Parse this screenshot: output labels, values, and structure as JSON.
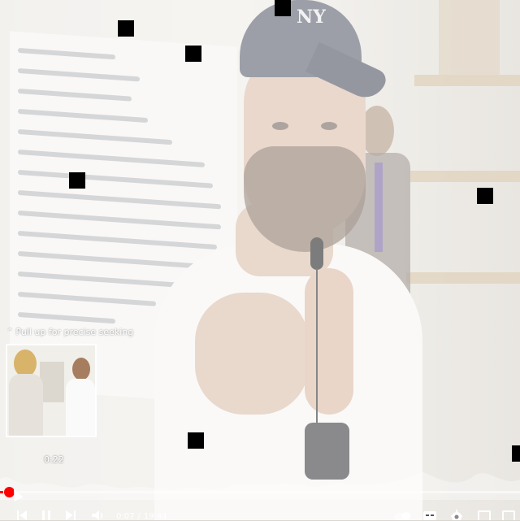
{
  "player": {
    "seek_hint": "Pull up for precise seeking",
    "preview_time": "0:22",
    "current_time": "0:07",
    "time_separator": "/",
    "duration": "19:44",
    "progress": 0.006
  },
  "video": {
    "cap_logo": "NY"
  },
  "colors": {
    "progress": "#ff0000",
    "controls": "#ffffff"
  },
  "icons": {
    "seek_hint": "chevron-up-icon",
    "prev": "previous-icon",
    "pause": "pause-icon",
    "next": "next-icon",
    "volume": "volume-icon",
    "toggle": "autoplay-toggle-icon",
    "captions": "captions-icon",
    "settings": "gear-icon",
    "miniplayer": "miniplayer-icon",
    "fullscreen": "fullscreen-icon"
  }
}
